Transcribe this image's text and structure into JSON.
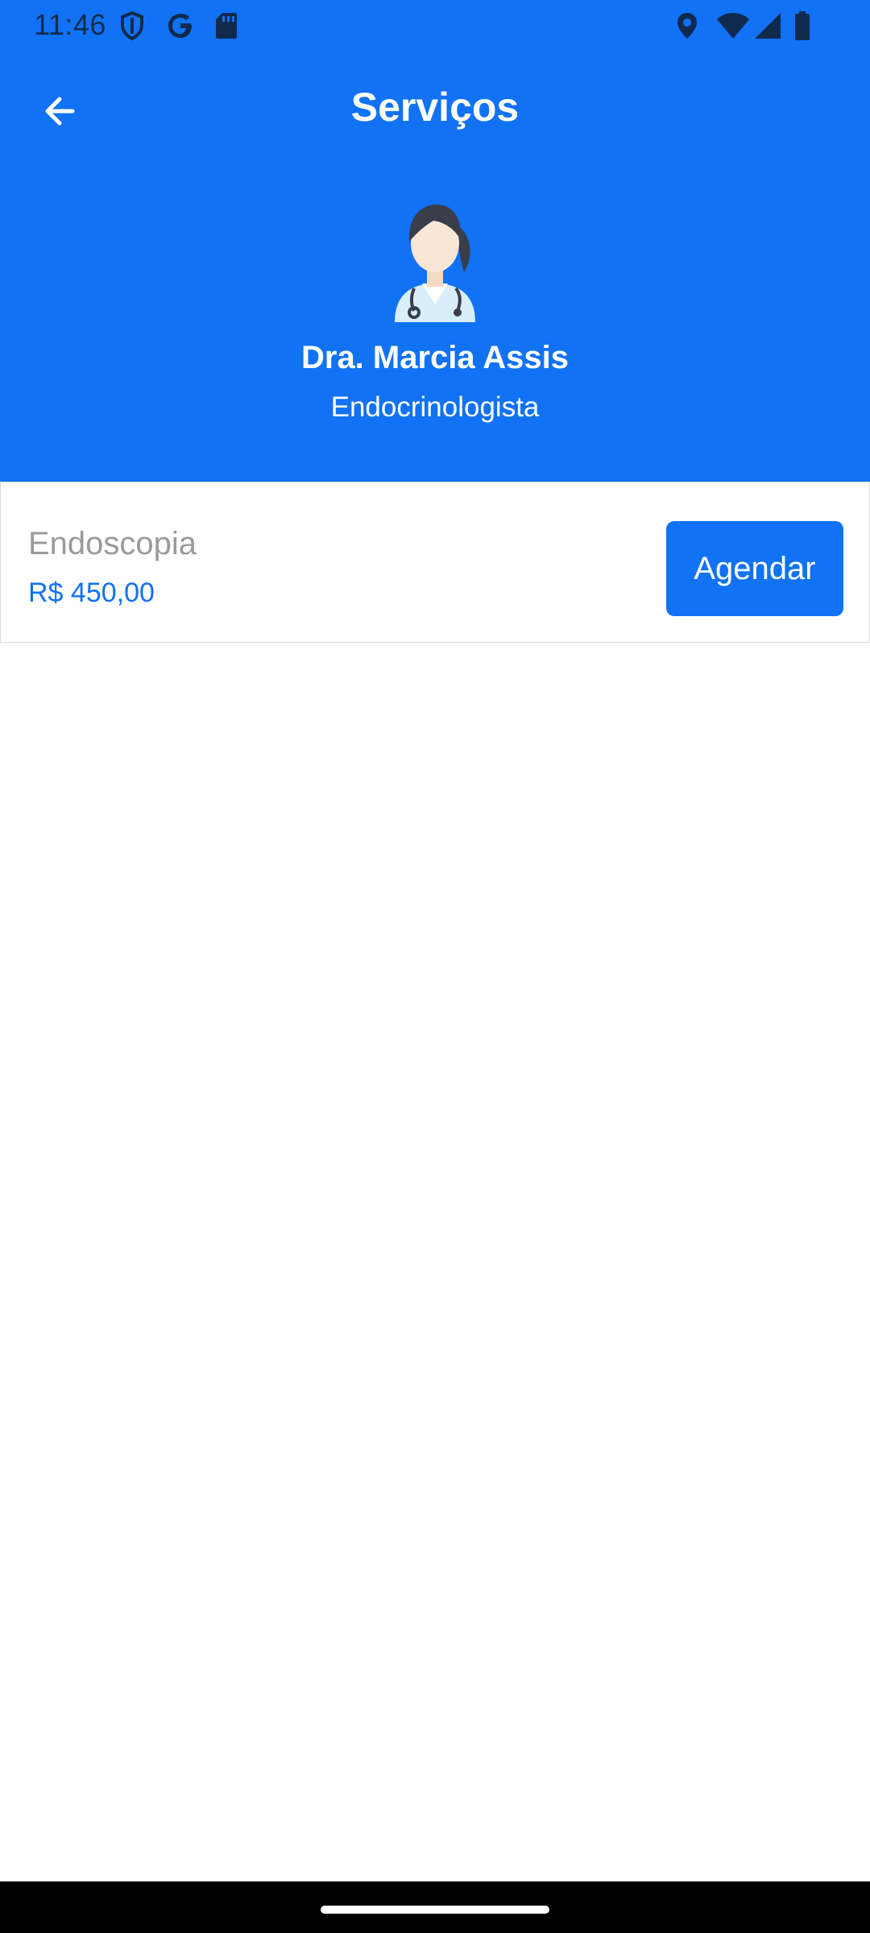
{
  "status_bar": {
    "time": "11:46",
    "left_icons": [
      "shield-icon",
      "google-icon",
      "sd-card-icon"
    ],
    "right_icons": [
      "location-icon",
      "wifi-icon",
      "signal-icon",
      "battery-icon"
    ]
  },
  "app_bar": {
    "back_icon": "arrow-left-icon",
    "title": "Serviços"
  },
  "profile": {
    "avatar_icon": "doctor-avatar-icon",
    "name": "Dra. Marcia Assis",
    "specialty": "Endocrinologista"
  },
  "services": [
    {
      "name": "Endoscopia",
      "price": "R$ 450,00",
      "action_label": "Agendar"
    }
  ],
  "colors": {
    "primary": "#1172f5",
    "muted_text": "#9a9a9a",
    "background": "#ffffff",
    "nav_bar": "#000000"
  }
}
